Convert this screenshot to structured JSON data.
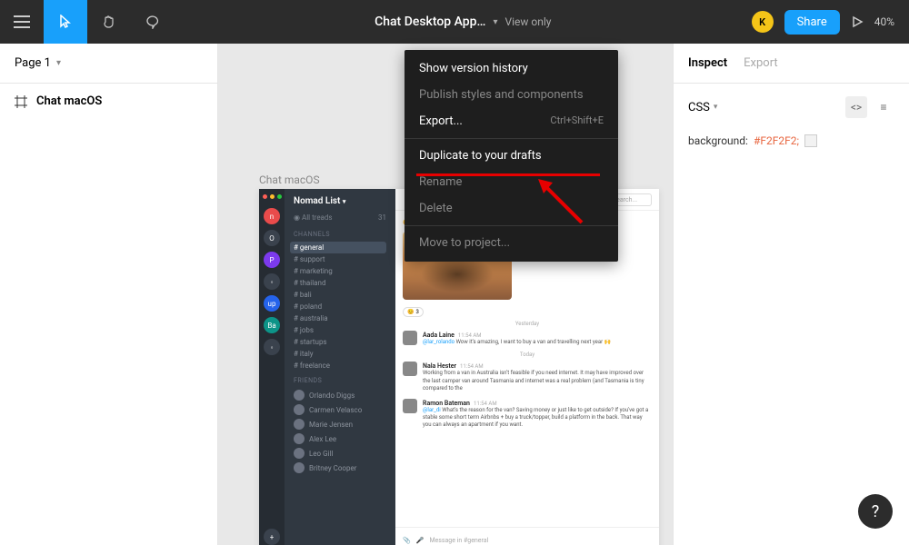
{
  "topbar": {
    "title": "Chat Desktop App…",
    "view_mode": "View only",
    "avatar_letter": "K",
    "share_label": "Share",
    "zoom": "40%"
  },
  "left": {
    "page_label": "Page 1",
    "frame_name": "Chat macOS"
  },
  "canvas": {
    "frame_label": "Chat macOS"
  },
  "chat": {
    "workspace": "Nomad List",
    "threads": "All treads",
    "threads_count": "31",
    "section_channels": "CHANNELS",
    "channels": [
      "# general",
      "# support",
      "# marketing",
      "# thailand",
      "# bali",
      "# poland",
      "# australia",
      "# jobs",
      "# startups",
      "# italy",
      "# freelance"
    ],
    "section_friends": "FRIENDS",
    "friends": [
      "Orlando Diggs",
      "Carmen Velasco",
      "Marie Jensen",
      "Alex Lee",
      "Leo Gill",
      "Britney Cooper"
    ],
    "search_placeholder": "Search...",
    "divider1": "Yesterday",
    "divider2": "Today",
    "msg1": {
      "name": "Aada Laine",
      "time": "11:54 AM",
      "text": "Wow it's amazing, I want to buy a van and travelling next year 🙌"
    },
    "msg1_mention": "@lar_rolando ",
    "msg2": {
      "name": "Nala Hester",
      "time": "11:54 AM",
      "text": "Working from a van in Australia isn't feasible if you need internet. It may have improved over the last camper van around Tasmania and internet was a real problem (and Tasmania is tiny compared to the"
    },
    "msg3": {
      "name": "Ramon Bateman",
      "time": "11:54 AM",
      "text": "What's the reason for the van? Saving money or just like to get outside? If you've got a stable some short term Airbnbs + buy a truck/topper, build a platform in the back. That way you can always an apartment if you want."
    },
    "msg3_mention": "@lar_di ",
    "react_count": "3",
    "input_placeholder": "Message in #general"
  },
  "menu": {
    "items": [
      "Show version history",
      "Publish styles and components",
      "Export...",
      "Duplicate to your drafts",
      "Rename",
      "Delete",
      "Move to project..."
    ],
    "export_shortcut": "Ctrl+Shift+E"
  },
  "inspect": {
    "tab_inspect": "Inspect",
    "tab_export": "Export",
    "lang": "CSS",
    "code_prop": "background:",
    "code_val": "#F2F2F2;"
  },
  "help": "?"
}
